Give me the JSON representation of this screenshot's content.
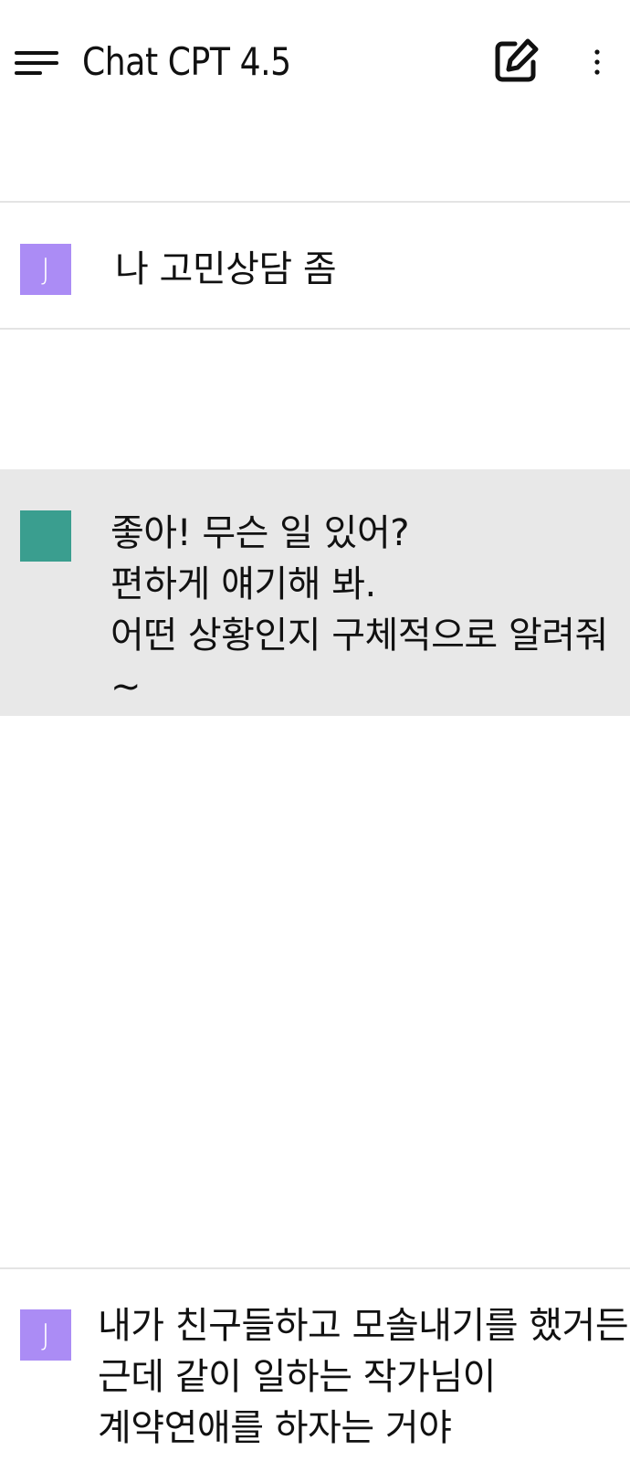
{
  "header": {
    "title": "Chat CPT 4.5",
    "menu_icon": "menu-icon",
    "new_chat_icon": "edit-square-icon",
    "more_icon": "more-vertical-icon"
  },
  "colors": {
    "user_avatar": "#ab8cf5",
    "assistant_avatar": "#3a9e8f",
    "assistant_bg": "#e8e8e8",
    "divider": "#e4e4e4"
  },
  "messages": [
    {
      "role": "user",
      "avatar_letter": "J",
      "text": "나 고민상담 좀"
    },
    {
      "role": "assistant",
      "avatar_letter": "",
      "text": "좋아! 무슨 일 있어?\n편하게 얘기해 봐.\n어떤 상황인지 구체적으로 알려줘~"
    },
    {
      "role": "user",
      "avatar_letter": "J",
      "text": "내가 친구들하고 모솔내기를 했거든\n근데 같이 일하는 작가님이\n계약연애를 하자는 거야"
    }
  ]
}
